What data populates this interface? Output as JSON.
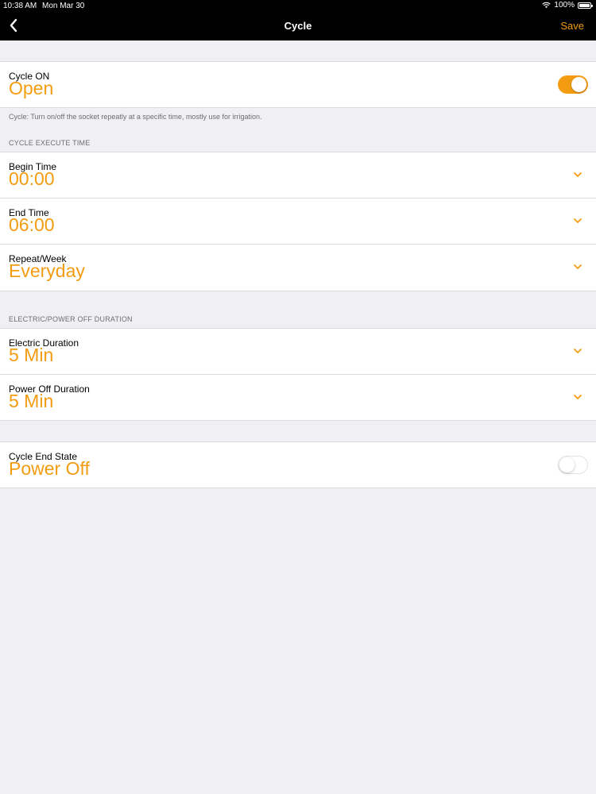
{
  "status_bar": {
    "time": "10:38 AM",
    "date": "Mon Mar 30",
    "battery": "100%"
  },
  "nav": {
    "title": "Cycle",
    "save_label": "Save",
    "back_icon": "chevron-left-icon"
  },
  "cycle_on": {
    "label": "Cycle ON",
    "value": "Open",
    "toggle_on": true
  },
  "cycle_note": "Cycle: Turn on/off the socket repeatly at a specific time, mostly use for irrigation.",
  "execute_section": {
    "header": "CYCLE EXECUTE TIME",
    "begin": {
      "label": "Begin Time",
      "value": "00:00"
    },
    "end": {
      "label": "End Time",
      "value": "06:00"
    },
    "repeat": {
      "label": "Repeat/Week",
      "value": "Everyday"
    }
  },
  "duration_section": {
    "header": "ELECTRIC/POWER OFF DURATION",
    "electric": {
      "label": "Electric Duration",
      "value": "5 Min"
    },
    "power_off": {
      "label": "Power Off Duration",
      "value": "5 Min"
    }
  },
  "end_state": {
    "label": "Cycle End State",
    "value": "Power Off",
    "toggle_on": false
  },
  "colors": {
    "accent": "#f39c12",
    "background": "#efeff4",
    "navbar": "#000000"
  }
}
